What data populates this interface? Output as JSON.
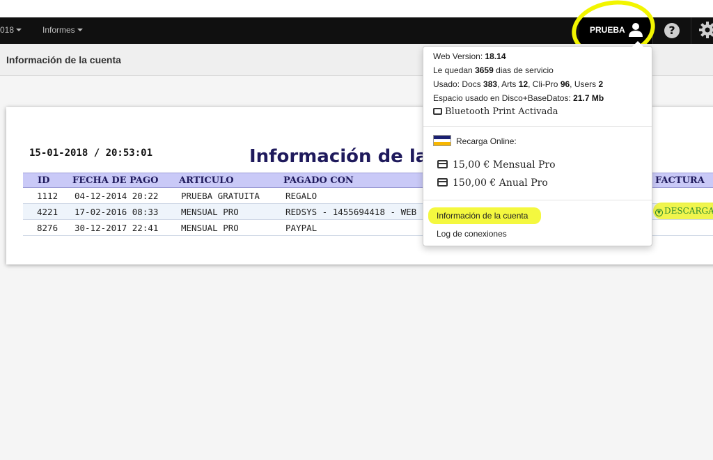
{
  "navbar": {
    "year_fragment": "018",
    "informes_label": "Informes",
    "user_label": "PRUEBA",
    "help_glyph": "?"
  },
  "page": {
    "title": "Información de la cuenta"
  },
  "content": {
    "datetime": "15-01-2018 / 20:53:01",
    "heading": "Información de la",
    "table": {
      "headers": [
        "ID",
        "FECHA DE PAGO",
        "ARTICULO",
        "PAGADO CON",
        "FACTURA"
      ],
      "rows": [
        {
          "id": "1112",
          "fecha": "04-12-2014 20:22",
          "articulo": "PRUEBA GRATUITA",
          "pagado": "REGALO",
          "factura": ""
        },
        {
          "id": "4221",
          "fecha": "17-02-2016 08:33",
          "articulo": "MENSUAL PRO",
          "pagado": "REDSYS - 1455694418 - WEB",
          "factura": "DESCARGAR"
        },
        {
          "id": "8276",
          "fecha": "30-12-2017 22:41",
          "articulo": "MENSUAL PRO",
          "pagado": "PAYPAL",
          "factura": ""
        }
      ]
    }
  },
  "dropdown": {
    "web_version_label": "Web Version:",
    "web_version": "18.14",
    "quedan_prefix": "Le quedan",
    "quedan_value": "3659",
    "quedan_suffix": "dias de servicio",
    "usado_prefix": "Usado: Docs",
    "docs": "383",
    "arts_label": ", Arts",
    "arts": "12",
    "clipro_label": ", Cli-Pro",
    "clipro": "96",
    "users_label": ", Users",
    "users": "2",
    "espacio_label": "Espacio usado en Disco+BaseDatos:",
    "espacio_value": "21.7 Mb",
    "bluetooth": "Bluetooth Print Activada",
    "recarga": "Recarga Online:",
    "plan_mensual": "15,00 € Mensual Pro",
    "plan_anual": "150,00 € Anual Pro",
    "info_cuenta": "Información de la cuenta",
    "log": "Log de conexiones"
  },
  "colors": {
    "highlight": "#f2f500",
    "navbar": "#101010",
    "table_header": "#c9c9f7",
    "heading": "#1f1a5c",
    "download": "#2e8b2e"
  }
}
